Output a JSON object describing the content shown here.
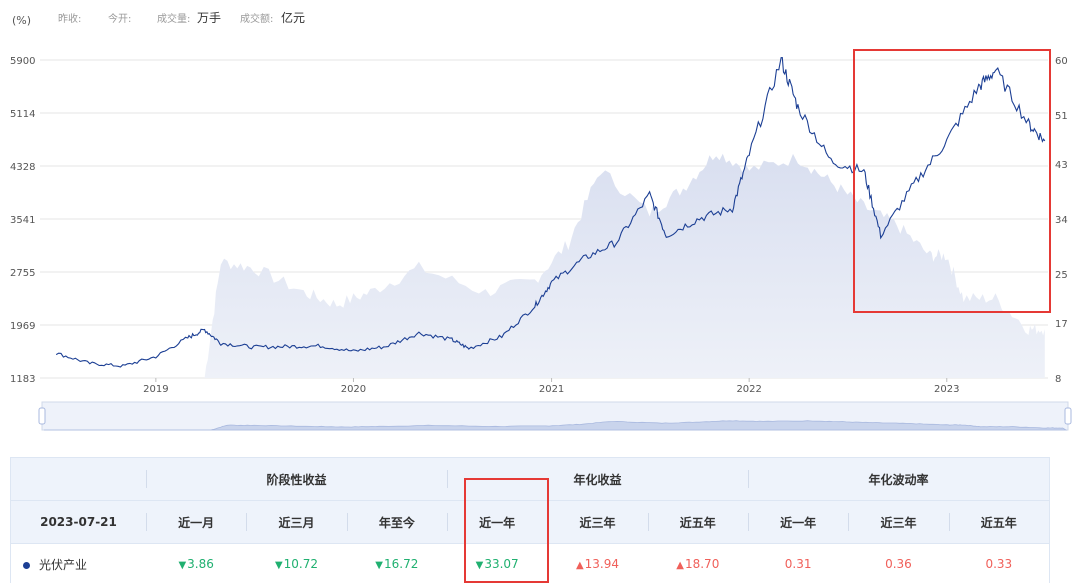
{
  "header": {
    "unit": "(%)",
    "prev_close_label": "昨收:",
    "open_label": "今开:",
    "volume_label": "成交量:",
    "volume_unit": "万手",
    "turnover_label": "成交额:",
    "turnover_unit": "亿元"
  },
  "chart_data": {
    "type": "line",
    "x_ticks": [
      "2019",
      "2020",
      "2021",
      "2022",
      "2023"
    ],
    "y_left_ticks": [
      1183,
      1969,
      2755,
      3541,
      4328,
      5114,
      5900
    ],
    "y_right_ticks": [
      8,
      17,
      25,
      34,
      43,
      51,
      60
    ],
    "ylim_left": [
      1183,
      5900
    ],
    "ylim_right": [
      8,
      60
    ],
    "grid": true,
    "series": [
      {
        "axis": "left",
        "style": "line",
        "color": "#1c3f94",
        "x": [
          "2018-07",
          "2018-09",
          "2018-11",
          "2019-01",
          "2019-03",
          "2019-04",
          "2019-05",
          "2019-07",
          "2019-09",
          "2019-11",
          "2020-01",
          "2020-03",
          "2020-05",
          "2020-07",
          "2020-08",
          "2020-10",
          "2020-12",
          "2021-01",
          "2021-03",
          "2021-05",
          "2021-07",
          "2021-08",
          "2021-10",
          "2021-12",
          "2022-01",
          "2022-03",
          "2022-04",
          "2022-06",
          "2022-08",
          "2022-09",
          "2022-11",
          "2023-01",
          "2023-03",
          "2023-04",
          "2023-06",
          "2023-07"
        ],
        "values": [
          1550,
          1400,
          1360,
          1500,
          1780,
          1900,
          1700,
          1640,
          1650,
          1660,
          1580,
          1650,
          1850,
          1750,
          1620,
          1800,
          2250,
          2600,
          2950,
          3200,
          3900,
          3300,
          3550,
          3700,
          4500,
          5900,
          5200,
          4400,
          4250,
          3300,
          4050,
          4700,
          5500,
          5750,
          4950,
          4700
        ]
      },
      {
        "axis": "right",
        "style": "area",
        "color": "#dfe5f2",
        "x": [
          "2019-04",
          "2019-05",
          "2019-07",
          "2019-10",
          "2019-12",
          "2020-02",
          "2020-05",
          "2020-09",
          "2020-12",
          "2021-02",
          "2021-04",
          "2021-07",
          "2021-09",
          "2021-11",
          "2022-01",
          "2022-04",
          "2022-06",
          "2022-08",
          "2022-10",
          "2022-12",
          "2023-01",
          "2023-02",
          "2023-04",
          "2023-06",
          "2023-07"
        ],
        "values": [
          8,
          27,
          26,
          22,
          20,
          22,
          26,
          22,
          24,
          30,
          42,
          35,
          39,
          45,
          42,
          44,
          40,
          36,
          33,
          28,
          28,
          21,
          21,
          16,
          16
        ]
      }
    ]
  },
  "stats_table": {
    "groups": [
      "阶段性收益",
      "年化收益",
      "年化波动率"
    ],
    "date": "2023-07-21",
    "columns": [
      "近一月",
      "近三月",
      "年至今",
      "近一年",
      "近三年",
      "近五年",
      "近一年",
      "近三年",
      "近五年"
    ],
    "row_name": "光伏产业",
    "values": [
      "3.86",
      "10.72",
      "16.72",
      "33.07",
      "13.94",
      "18.70",
      "0.31",
      "0.36",
      "0.33"
    ],
    "down_arrow": "▼",
    "up_arrow": "▲"
  }
}
